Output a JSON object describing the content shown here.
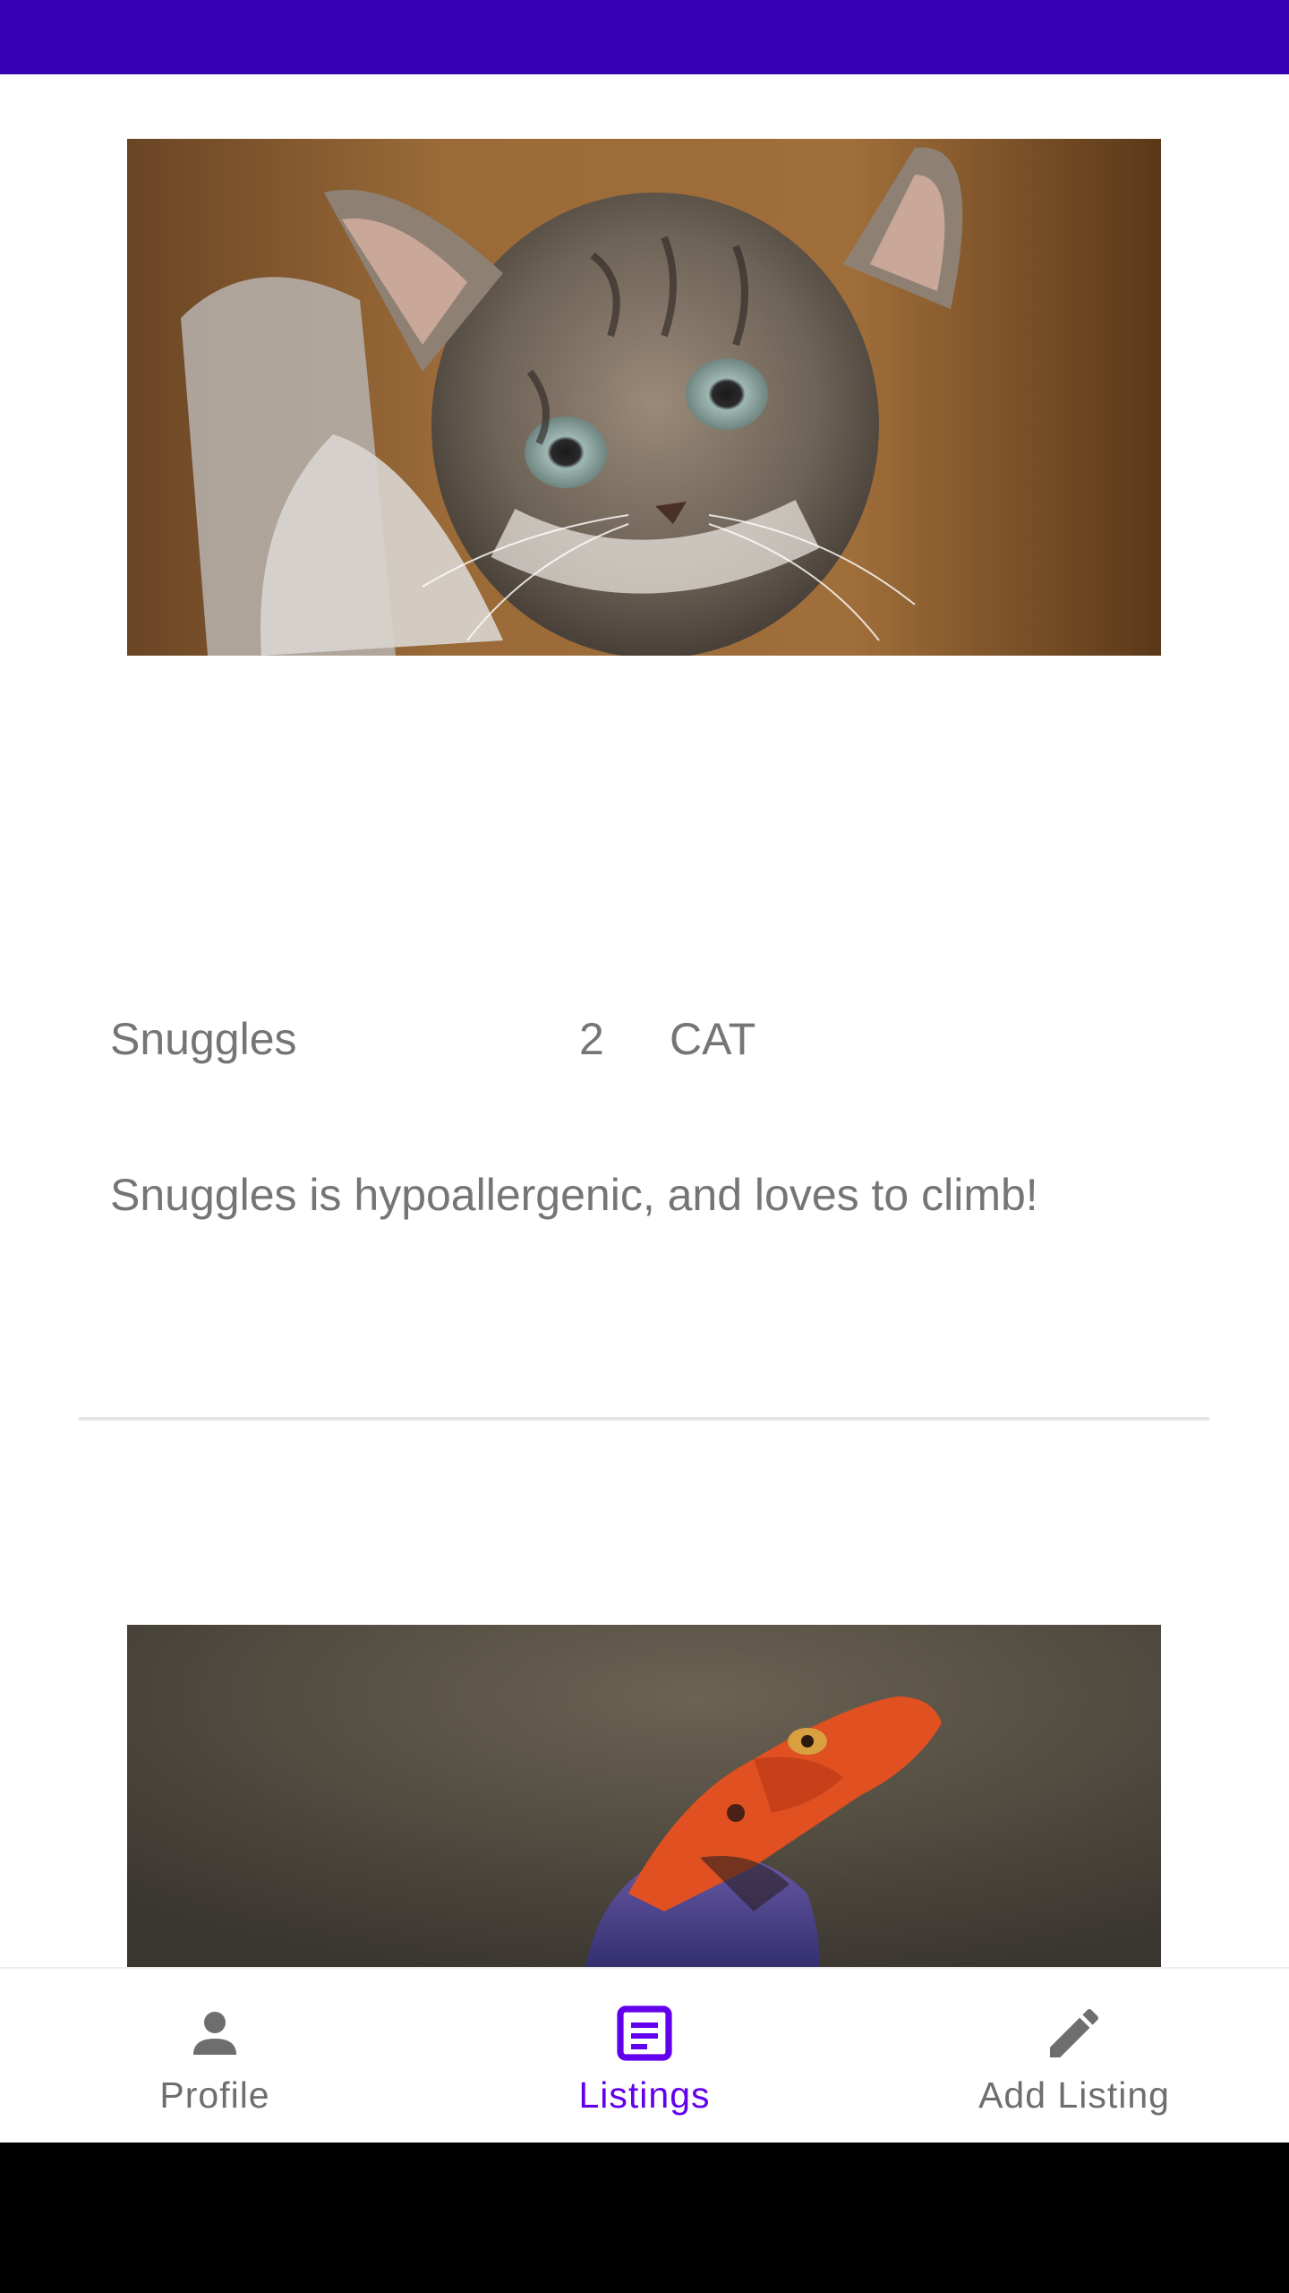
{
  "colors": {
    "status_bar": "#3700b3",
    "accent": "#6200ee",
    "nav_inactive": "#6e6e6e",
    "text_secondary": "#757575"
  },
  "listings": [
    {
      "image": "kitten-photo",
      "name": "Snuggles",
      "age": "2",
      "type": "CAT",
      "description": "Snuggles is hypoallergenic, and loves to climb!"
    },
    {
      "image": "lizard-photo"
    }
  ],
  "bottom_nav": {
    "items": [
      {
        "label": "Profile",
        "icon": "person-icon",
        "active": false
      },
      {
        "label": "Listings",
        "icon": "listings-icon",
        "active": true
      },
      {
        "label": "Add Listing",
        "icon": "pencil-icon",
        "active": false
      }
    ]
  }
}
